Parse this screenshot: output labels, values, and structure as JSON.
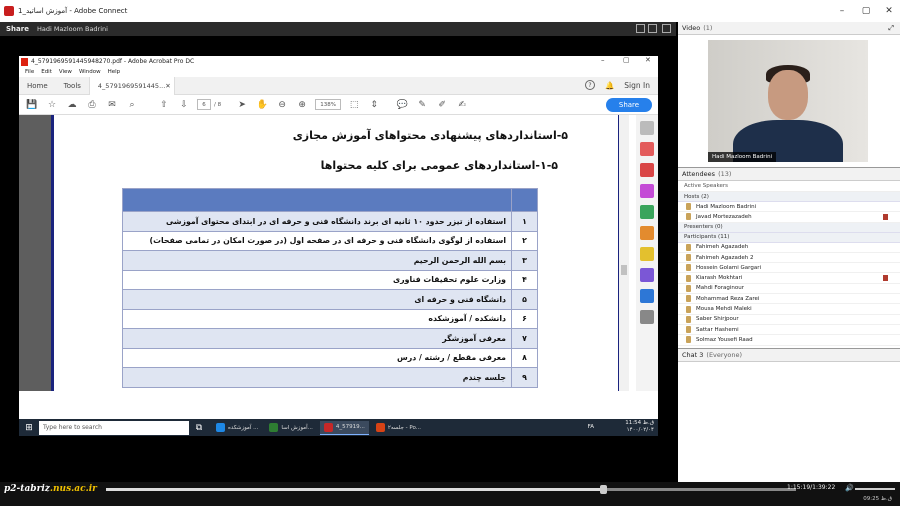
{
  "window": {
    "title": "آموزش اساتید_1 - Adobe Connect",
    "controls": [
      "–",
      "▢",
      "✕"
    ]
  },
  "share_pod": {
    "title": "Share",
    "presenter": "Hadi Mazloom Badrini"
  },
  "acrobat": {
    "title": "4_5791969591445948270.pdf - Adobe Acrobat Pro DC",
    "menu": [
      "File",
      "Edit",
      "View",
      "Window",
      "Help"
    ],
    "tabs": {
      "home": "Home",
      "tools": "Tools",
      "doc": "4_5791969591445..."
    },
    "sign_in": "Sign In",
    "page_current": "6",
    "page_total": "/ 8",
    "zoom": "138%",
    "share": "Share"
  },
  "document": {
    "heading_5": "۵-استانداردهای پیشنهادی محتواهای آموزش مجازی",
    "heading_5_1": "۱-۵-استانداردهای عمومی برای کلیه محتواها",
    "rows": [
      {
        "num": "۱",
        "text": "استفاده از تیزر حدود ۱۰ ثانیه ای برند دانشگاه فنی و حرفه ای در ابتدای محتوای آموزشی"
      },
      {
        "num": "۲",
        "text": "استفاده از لوگوی دانشگاه فنی و حرفه ای در صفحه اول (در صورت امکان در تمامی صفحات)"
      },
      {
        "num": "۳",
        "text": "بسم الله الرحمن الرحیم"
      },
      {
        "num": "۴",
        "text": "وزارت علوم تحقیقات فناوری"
      },
      {
        "num": "۵",
        "text": "دانشگاه فنی و حرفه ای"
      },
      {
        "num": "۶",
        "text": "دانشکده / آموزشکده"
      },
      {
        "num": "۷",
        "text": "معرفی آموزشگر"
      },
      {
        "num": "۸",
        "text": "معرفی مقطع / رشته / درس"
      },
      {
        "num": "۹",
        "text": "جلسه چندم"
      }
    ]
  },
  "taskbar": {
    "search_placeholder": "Type here to search",
    "apps": [
      {
        "label": "آموزشکده ...",
        "color": "#1e88e5"
      },
      {
        "label": "آموزش اسا...",
        "color": "#2e7d32"
      },
      {
        "label": "4_57919...",
        "color": "#c62828"
      },
      {
        "label": "جلسه۲ - Po...",
        "color": "#d84315"
      }
    ],
    "time": "11:54 ق.ظ",
    "date": "۱۴۰۰/۰۲/۰۴",
    "lang": "FA"
  },
  "video_pod": {
    "title": "Video",
    "count": "(1)",
    "name_tag": "Hadi Mazloom Badrini"
  },
  "attendees_pod": {
    "title": "Attendees",
    "count": "(13)",
    "active_speakers": "Active Speakers",
    "hosts_label": "Hosts (2)",
    "hosts": [
      "Hadi Mazloom Badrini",
      "Javad Mortezazadeh"
    ],
    "presenters_label": "Presenters (0)",
    "participants_label": "Participants (11)",
    "participants": [
      "Fahimeh Agazadeh",
      "Fahimeh Agazadeh 2",
      "Hossein Golami Gargari",
      "Kiarash Mokhtari",
      "Mahdi Foraginour",
      "Mohammad Reza Zarei",
      "Mousa Mehdi Maleki",
      "Saber Shirjpour",
      "Sattar Hashemi",
      "Solmaz Yousefi Raad"
    ]
  },
  "chat_pod": {
    "title": "Chat 3",
    "scope": "(Everyone)"
  },
  "playback": {
    "logo_main": "p2-tabriz",
    "logo_domain": ".nus.ac.ir",
    "progress": 0.72,
    "time": "1:15:19/1:39:22",
    "clock": "09:25 ق.ظ"
  }
}
